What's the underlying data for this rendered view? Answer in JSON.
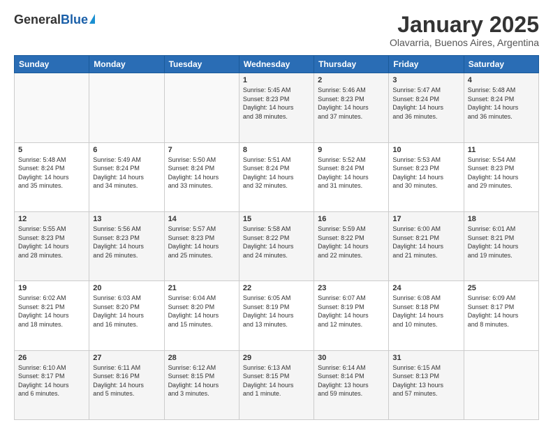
{
  "header": {
    "logo_general": "General",
    "logo_blue": "Blue",
    "title": "January 2025",
    "subtitle": "Olavarria, Buenos Aires, Argentina"
  },
  "calendar": {
    "days_of_week": [
      "Sunday",
      "Monday",
      "Tuesday",
      "Wednesday",
      "Thursday",
      "Friday",
      "Saturday"
    ],
    "weeks": [
      [
        {
          "day": "",
          "info": ""
        },
        {
          "day": "",
          "info": ""
        },
        {
          "day": "",
          "info": ""
        },
        {
          "day": "1",
          "info": "Sunrise: 5:45 AM\nSunset: 8:23 PM\nDaylight: 14 hours\nand 38 minutes."
        },
        {
          "day": "2",
          "info": "Sunrise: 5:46 AM\nSunset: 8:23 PM\nDaylight: 14 hours\nand 37 minutes."
        },
        {
          "day": "3",
          "info": "Sunrise: 5:47 AM\nSunset: 8:24 PM\nDaylight: 14 hours\nand 36 minutes."
        },
        {
          "day": "4",
          "info": "Sunrise: 5:48 AM\nSunset: 8:24 PM\nDaylight: 14 hours\nand 36 minutes."
        }
      ],
      [
        {
          "day": "5",
          "info": "Sunrise: 5:48 AM\nSunset: 8:24 PM\nDaylight: 14 hours\nand 35 minutes."
        },
        {
          "day": "6",
          "info": "Sunrise: 5:49 AM\nSunset: 8:24 PM\nDaylight: 14 hours\nand 34 minutes."
        },
        {
          "day": "7",
          "info": "Sunrise: 5:50 AM\nSunset: 8:24 PM\nDaylight: 14 hours\nand 33 minutes."
        },
        {
          "day": "8",
          "info": "Sunrise: 5:51 AM\nSunset: 8:24 PM\nDaylight: 14 hours\nand 32 minutes."
        },
        {
          "day": "9",
          "info": "Sunrise: 5:52 AM\nSunset: 8:24 PM\nDaylight: 14 hours\nand 31 minutes."
        },
        {
          "day": "10",
          "info": "Sunrise: 5:53 AM\nSunset: 8:23 PM\nDaylight: 14 hours\nand 30 minutes."
        },
        {
          "day": "11",
          "info": "Sunrise: 5:54 AM\nSunset: 8:23 PM\nDaylight: 14 hours\nand 29 minutes."
        }
      ],
      [
        {
          "day": "12",
          "info": "Sunrise: 5:55 AM\nSunset: 8:23 PM\nDaylight: 14 hours\nand 28 minutes."
        },
        {
          "day": "13",
          "info": "Sunrise: 5:56 AM\nSunset: 8:23 PM\nDaylight: 14 hours\nand 26 minutes."
        },
        {
          "day": "14",
          "info": "Sunrise: 5:57 AM\nSunset: 8:23 PM\nDaylight: 14 hours\nand 25 minutes."
        },
        {
          "day": "15",
          "info": "Sunrise: 5:58 AM\nSunset: 8:22 PM\nDaylight: 14 hours\nand 24 minutes."
        },
        {
          "day": "16",
          "info": "Sunrise: 5:59 AM\nSunset: 8:22 PM\nDaylight: 14 hours\nand 22 minutes."
        },
        {
          "day": "17",
          "info": "Sunrise: 6:00 AM\nSunset: 8:21 PM\nDaylight: 14 hours\nand 21 minutes."
        },
        {
          "day": "18",
          "info": "Sunrise: 6:01 AM\nSunset: 8:21 PM\nDaylight: 14 hours\nand 19 minutes."
        }
      ],
      [
        {
          "day": "19",
          "info": "Sunrise: 6:02 AM\nSunset: 8:21 PM\nDaylight: 14 hours\nand 18 minutes."
        },
        {
          "day": "20",
          "info": "Sunrise: 6:03 AM\nSunset: 8:20 PM\nDaylight: 14 hours\nand 16 minutes."
        },
        {
          "day": "21",
          "info": "Sunrise: 6:04 AM\nSunset: 8:20 PM\nDaylight: 14 hours\nand 15 minutes."
        },
        {
          "day": "22",
          "info": "Sunrise: 6:05 AM\nSunset: 8:19 PM\nDaylight: 14 hours\nand 13 minutes."
        },
        {
          "day": "23",
          "info": "Sunrise: 6:07 AM\nSunset: 8:19 PM\nDaylight: 14 hours\nand 12 minutes."
        },
        {
          "day": "24",
          "info": "Sunrise: 6:08 AM\nSunset: 8:18 PM\nDaylight: 14 hours\nand 10 minutes."
        },
        {
          "day": "25",
          "info": "Sunrise: 6:09 AM\nSunset: 8:17 PM\nDaylight: 14 hours\nand 8 minutes."
        }
      ],
      [
        {
          "day": "26",
          "info": "Sunrise: 6:10 AM\nSunset: 8:17 PM\nDaylight: 14 hours\nand 6 minutes."
        },
        {
          "day": "27",
          "info": "Sunrise: 6:11 AM\nSunset: 8:16 PM\nDaylight: 14 hours\nand 5 minutes."
        },
        {
          "day": "28",
          "info": "Sunrise: 6:12 AM\nSunset: 8:15 PM\nDaylight: 14 hours\nand 3 minutes."
        },
        {
          "day": "29",
          "info": "Sunrise: 6:13 AM\nSunset: 8:15 PM\nDaylight: 14 hours\nand 1 minute."
        },
        {
          "day": "30",
          "info": "Sunrise: 6:14 AM\nSunset: 8:14 PM\nDaylight: 13 hours\nand 59 minutes."
        },
        {
          "day": "31",
          "info": "Sunrise: 6:15 AM\nSunset: 8:13 PM\nDaylight: 13 hours\nand 57 minutes."
        },
        {
          "day": "",
          "info": ""
        }
      ]
    ]
  }
}
